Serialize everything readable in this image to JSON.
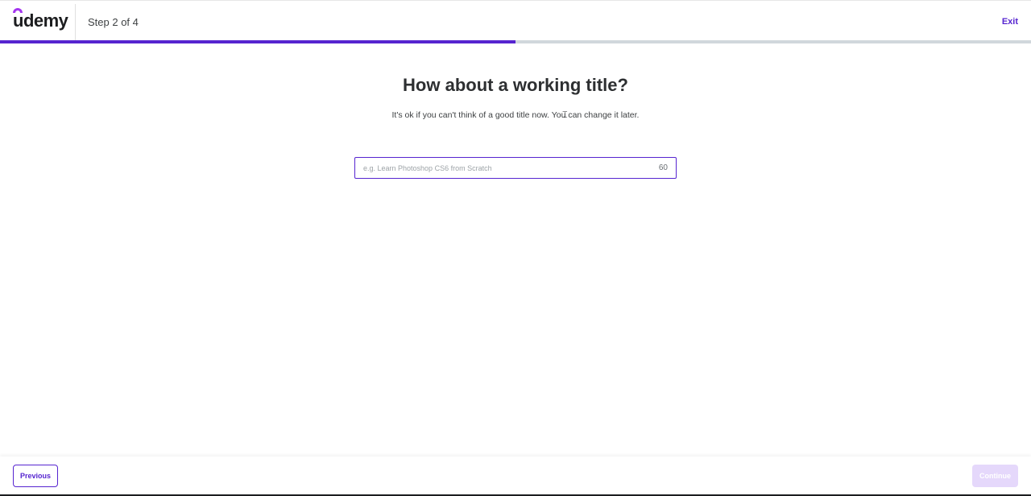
{
  "header": {
    "logo_text": "udemy",
    "step_label": "Step 2 of 4",
    "exit_label": "Exit"
  },
  "progress": {
    "fraction": 0.5,
    "fill_color": "#5624d0",
    "track_color": "#d1d7dc"
  },
  "main": {
    "title": "How about a working title?",
    "subtitle": "It's ok if you can't think of a good title now. You can change it later.",
    "title_input": {
      "value": "",
      "placeholder": "e.g. Learn Photoshop CS6 from Scratch",
      "char_remaining": "60"
    }
  },
  "footer": {
    "previous_label": "Previous",
    "continue_label": "Continue"
  },
  "colors": {
    "brand_purple": "#5624d0",
    "logo_accent": "#a435f0",
    "disabled_button": "#e5d8fb"
  }
}
